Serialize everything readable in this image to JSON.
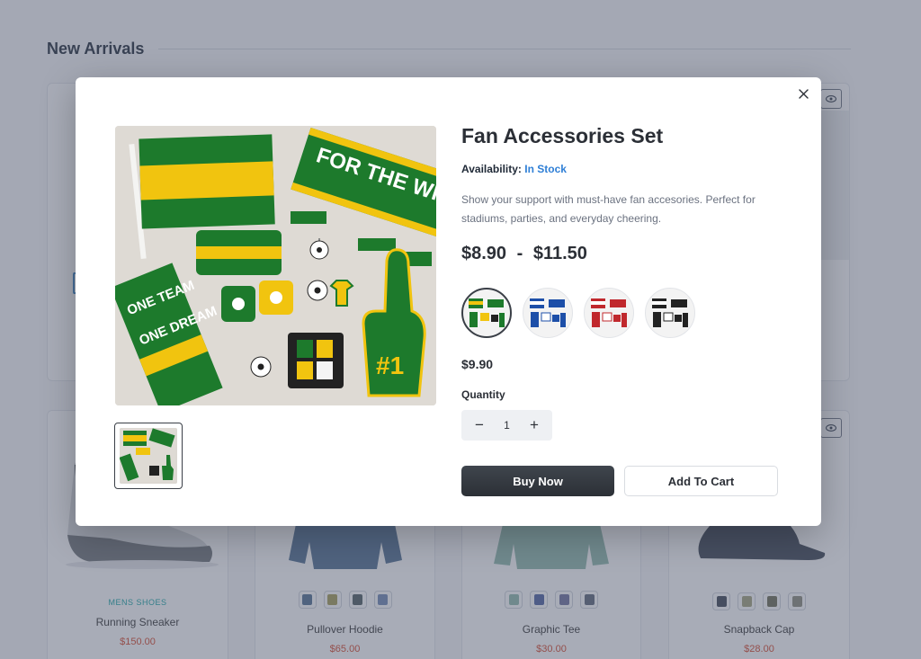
{
  "background": {
    "section_title": "New Arrivals",
    "products": [
      {
        "category": "MENS SHOES",
        "name": "Running Sneaker",
        "price": "$150.00"
      },
      {
        "category": "",
        "name": "Pullover Hoodie",
        "price": "$65.00"
      },
      {
        "category": "",
        "name": "Graphic Tee",
        "price": "$30.00"
      },
      {
        "category": "",
        "name": "Snapback Cap",
        "price": "$28.00"
      }
    ],
    "swatch_colors": {
      "hoodie": [
        "#4f6d8f",
        "#a39a55",
        "#4c5a5e",
        "#6f86b3"
      ],
      "tee": [
        "#8fb9ab",
        "#4a5e9e",
        "#6c6f9c",
        "#5b6477"
      ],
      "cap": [
        "#3b4350",
        "#a0a07a",
        "#6b6b52",
        "#8a8a7a"
      ]
    }
  },
  "modal": {
    "title": "Fan Accessories Set",
    "availability_label": "Availability:",
    "availability_value": "In Stock",
    "description": "Show your support with must-have fan accesories. Perfect for stadiums, parties, and everyday cheering.",
    "price_min": "$8.90",
    "price_sep": "-",
    "price_max": "$11.50",
    "selected_price": "$9.90",
    "quantity_label": "Quantity",
    "quantity_value": "1",
    "minus_symbol": "−",
    "plus_symbol": "+",
    "buy_now_label": "Buy Now",
    "add_to_cart_label": "Add To Cart",
    "image_text": {
      "scarf_top": "FOR THE WIN",
      "scarf_left_line1": "ONE TEAM",
      "scarf_left_line2": "ONE DREAM",
      "foam_finger": "#1"
    },
    "variants": [
      {
        "name": "green-yellow",
        "color": "#1d7a2c",
        "accent": "#f1c40f",
        "selected": true
      },
      {
        "name": "blue-white",
        "color": "#1d4fa8",
        "accent": "#ffffff",
        "selected": false
      },
      {
        "name": "red-white",
        "color": "#c0282d",
        "accent": "#ffffff",
        "selected": false
      },
      {
        "name": "black-white",
        "color": "#222222",
        "accent": "#ffffff",
        "selected": false
      }
    ]
  },
  "colors": {
    "accent_blue": "#2f7fd6",
    "primary_button": "#3a3f47",
    "price_red": "#d64528",
    "category_teal": "#16a3a3"
  }
}
